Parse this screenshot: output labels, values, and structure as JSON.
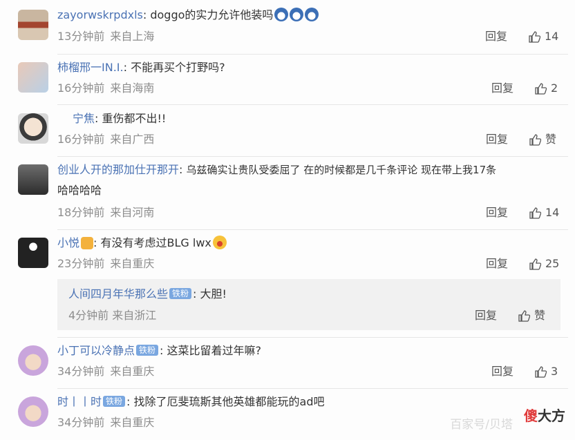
{
  "comments": [
    {
      "username": "zayorwskrpdxls",
      "text": "doggo的实力允许他装吗",
      "time": "13分钟前",
      "location": "来自上海",
      "reply": "回复",
      "likes": "14"
    },
    {
      "username": "柿榴邢一IN.I.",
      "text": "不能再买个打野吗?",
      "time": "16分钟前",
      "location": "来自海南",
      "reply": "回复",
      "likes": "2"
    },
    {
      "username": "宁焦",
      "text": "重伤都不出!!",
      "time": "16分钟前",
      "location": "来自广西",
      "reply": "回复",
      "likes": "赞"
    },
    {
      "username": "创业人开的那加仕开那开",
      "text": "乌兹确实让贵队受委屈了 在的时候都是几千条评论 现在带上我17条",
      "text_line2": "哈哈哈哈",
      "time": "18分钟前",
      "location": "来自河南",
      "reply": "回复",
      "likes": "14"
    },
    {
      "username": "小悦",
      "text": "有没有考虑过BLG lwx",
      "time": "23分钟前",
      "location": "来自重庆",
      "reply": "回复",
      "likes": "25"
    },
    {
      "username": "小丁可以冷静点",
      "badge": "铁粉",
      "text": "这菜比留着过年嘛?",
      "time": "34分钟前",
      "location": "来自重庆",
      "reply": "回复",
      "likes": "3"
    },
    {
      "username": "时丨丨时",
      "badge": "铁粉",
      "text": "找除了厄斐琉斯其他英雄都能玩的ad吧",
      "time": "34分钟前",
      "location": "来自重庆"
    }
  ],
  "subreply": {
    "username": "人间四月年华那么些",
    "badge": "铁粉",
    "text": "大胆!",
    "time": "4分钟前",
    "location": "来自浙江",
    "reply": "回复",
    "likes": "赞"
  },
  "watermark": {
    "text": "百家号/贝塔",
    "logo_a": "傻",
    "logo_b": "大方"
  }
}
